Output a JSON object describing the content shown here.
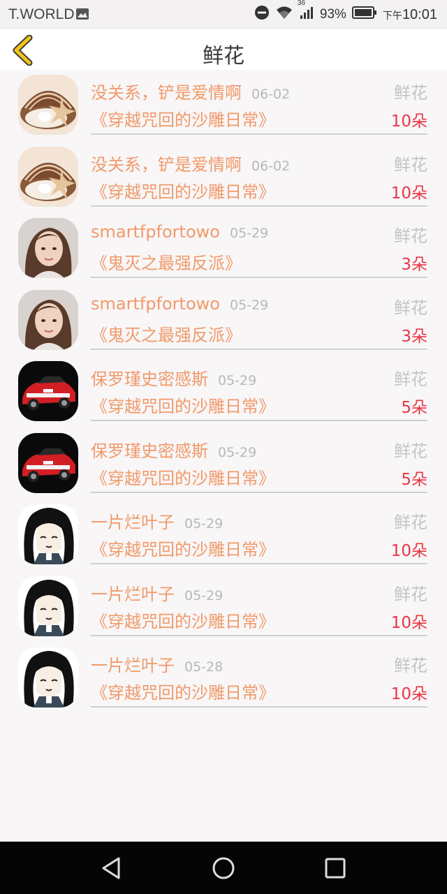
{
  "status_bar": {
    "carrier": "T.WORLD",
    "network": "36",
    "battery": "93%",
    "time_prefix": "下午",
    "time": "10:01"
  },
  "header": {
    "title": "鲜花"
  },
  "items": [
    {
      "avatar": "shell",
      "name": "没关系，铲是爱情啊",
      "date": "06-02",
      "gift": "鲜花",
      "book": "《穿越咒回的沙雕日常》",
      "count": "10朵"
    },
    {
      "avatar": "shell",
      "name": "没关系，铲是爱情啊",
      "date": "06-02",
      "gift": "鲜花",
      "book": "《穿越咒回的沙雕日常》",
      "count": "10朵"
    },
    {
      "avatar": "girl",
      "name": "smartfpfortowo",
      "date": "05-29",
      "gift": "鲜花",
      "book": "《鬼灭之最强反派》",
      "count": "3朵"
    },
    {
      "avatar": "girl",
      "name": "smartfpfortowo",
      "date": "05-29",
      "gift": "鲜花",
      "book": "《鬼灭之最强反派》",
      "count": "3朵"
    },
    {
      "avatar": "car",
      "name": "保罗瑾史密感斯",
      "date": "05-29",
      "gift": "鲜花",
      "book": "《穿越咒回的沙雕日常》",
      "count": "5朵"
    },
    {
      "avatar": "car",
      "name": "保罗瑾史密感斯",
      "date": "05-29",
      "gift": "鲜花",
      "book": "《穿越咒回的沙雕日常》",
      "count": "5朵"
    },
    {
      "avatar": "anime",
      "name": "一片烂叶子",
      "date": "05-29",
      "gift": "鲜花",
      "book": "《穿越咒回的沙雕日常》",
      "count": "10朵"
    },
    {
      "avatar": "anime",
      "name": "一片烂叶子",
      "date": "05-29",
      "gift": "鲜花",
      "book": "《穿越咒回的沙雕日常》",
      "count": "10朵"
    },
    {
      "avatar": "anime",
      "name": "一片烂叶子",
      "date": "05-28",
      "gift": "鲜花",
      "book": "《穿越咒回的沙雕日常》",
      "count": "10朵"
    }
  ],
  "colors": {
    "name": "#f19a6a",
    "count": "#e93545",
    "back_arrow": "#f0c419"
  }
}
